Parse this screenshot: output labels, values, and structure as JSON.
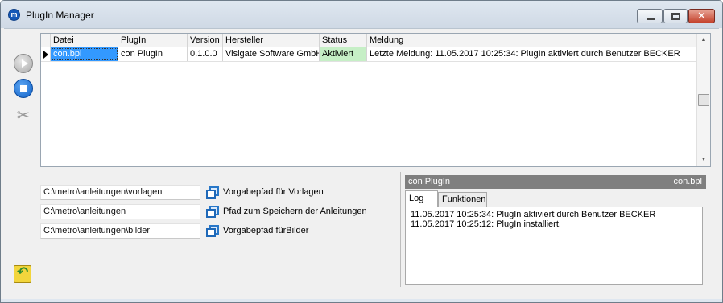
{
  "window": {
    "title": "PlugIn Manager",
    "app_icon_glyph": "m"
  },
  "toolbar": {
    "icons": [
      "play-icon",
      "stop-icon",
      "scissors-icon"
    ]
  },
  "grid": {
    "columns": [
      "Datei",
      "PlugIn",
      "Version",
      "Hersteller",
      "Status",
      "Meldung"
    ],
    "rows": [
      {
        "datei": "con.bpl",
        "plugin": "con PlugIn",
        "version": "0.1.0.0",
        "hersteller": "Visigate Software GmbH",
        "status": "Aktiviert",
        "meldung": "Letzte Meldung: 11.05.2017 10:25:34: PlugIn aktiviert durch Benutzer BECKER"
      }
    ]
  },
  "paths": [
    {
      "value": "C:\\metro\\anleitungen\\vorlagen",
      "label": "Vorgabepfad für Vorlagen"
    },
    {
      "value": "C:\\metro\\anleitungen",
      "label": "Pfad zum Speichern der Anleitungen"
    },
    {
      "value": "C:\\metro\\anleitungen\\bilder",
      "label": "Vorgabepfad fürBilder"
    }
  ],
  "detail": {
    "header_left": "con PlugIn",
    "header_right": "con.bpl",
    "tabs": [
      "Log",
      "Funktionen"
    ],
    "active_tab": "Log",
    "log_lines": [
      "11.05.2017 10:25:34: PlugIn aktiviert durch Benutzer BECKER",
      "11.05.2017 10:25:12: PlugIn installiert."
    ]
  },
  "colors": {
    "selection": "#3399ff",
    "status_active": "#c6efc6",
    "panel_header": "#7f7f7f"
  }
}
